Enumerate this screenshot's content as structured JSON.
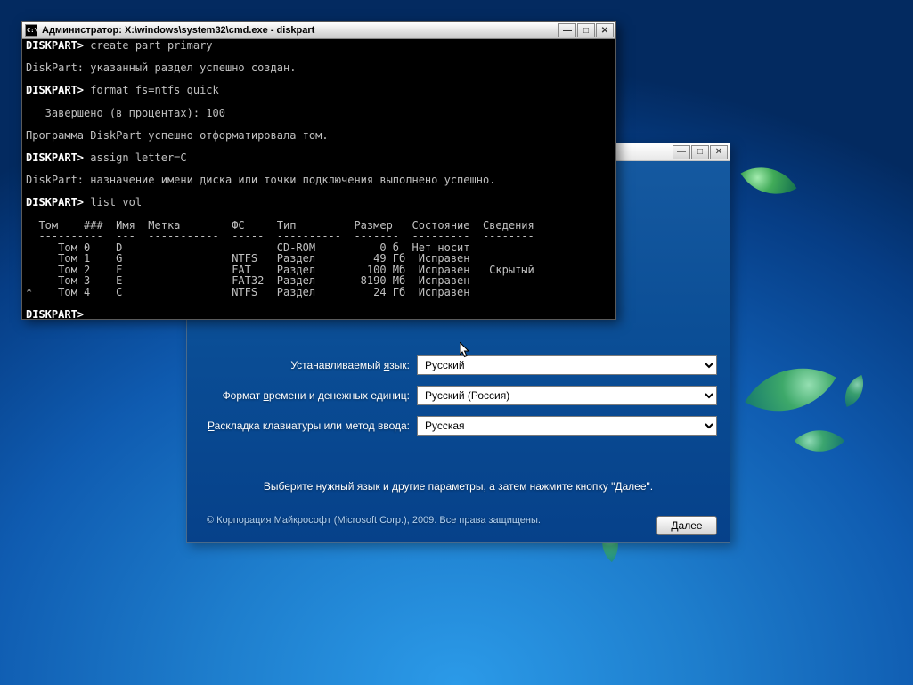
{
  "background_leaves": true,
  "installer": {
    "titlebar": {
      "minimize": "—",
      "maximize": "□",
      "close": "✕"
    },
    "labels": {
      "language": "Устанавливаемый язык:",
      "time_currency": "Формат времени и денежных единиц:",
      "keyboard": "Раскладка клавиатуры или метод ввода:"
    },
    "values": {
      "language": "Русский",
      "time_currency": "Русский (Россия)",
      "keyboard": "Русская"
    },
    "instruction": "Выберите нужный язык и другие параметры, а затем нажмите кнопку \"Далее\".",
    "copyright": "© Корпорация Майкрософт (Microsoft Corp.), 2009. Все права защищены.",
    "next": "Далее"
  },
  "cmd": {
    "title": "Администратор: X:\\windows\\system32\\cmd.exe - diskpart",
    "icon_text": "C:\\",
    "titlebar": {
      "minimize": "—",
      "maximize": "□",
      "close": "✕"
    },
    "lines": [
      "DISKPART> create part primary",
      "",
      "DiskPart: указанный раздел успешно создан.",
      "",
      "DISKPART> format fs=ntfs quick",
      "",
      "   Завершено (в процентах): 100",
      "",
      "Программа DiskPart успешно отформатировала том.",
      "",
      "DISKPART> assign letter=C",
      "",
      "DiskPart: назначение имени диска или точки подключения выполнено успешно.",
      "",
      "DISKPART> list vol",
      "",
      "  Том    ###  Имя  Метка        ФС     Тип         Размер   Состояние  Сведения",
      "  ----------  ---  -----------  -----  ----------  -------  ---------  --------",
      "     Том 0    D                        CD-ROM          0 б  Нет носит",
      "     Том 1    G                 NTFS   Раздел         49 Гб  Исправен",
      "     Том 2    F                 FAT    Раздел        100 Мб  Исправен   Скрытый",
      "     Том 3    E                 FAT32  Раздел       8190 Мб  Исправен",
      "*    Том 4    C                 NTFS   Раздел         24 Гб  Исправен",
      "",
      "DISKPART>"
    ]
  }
}
